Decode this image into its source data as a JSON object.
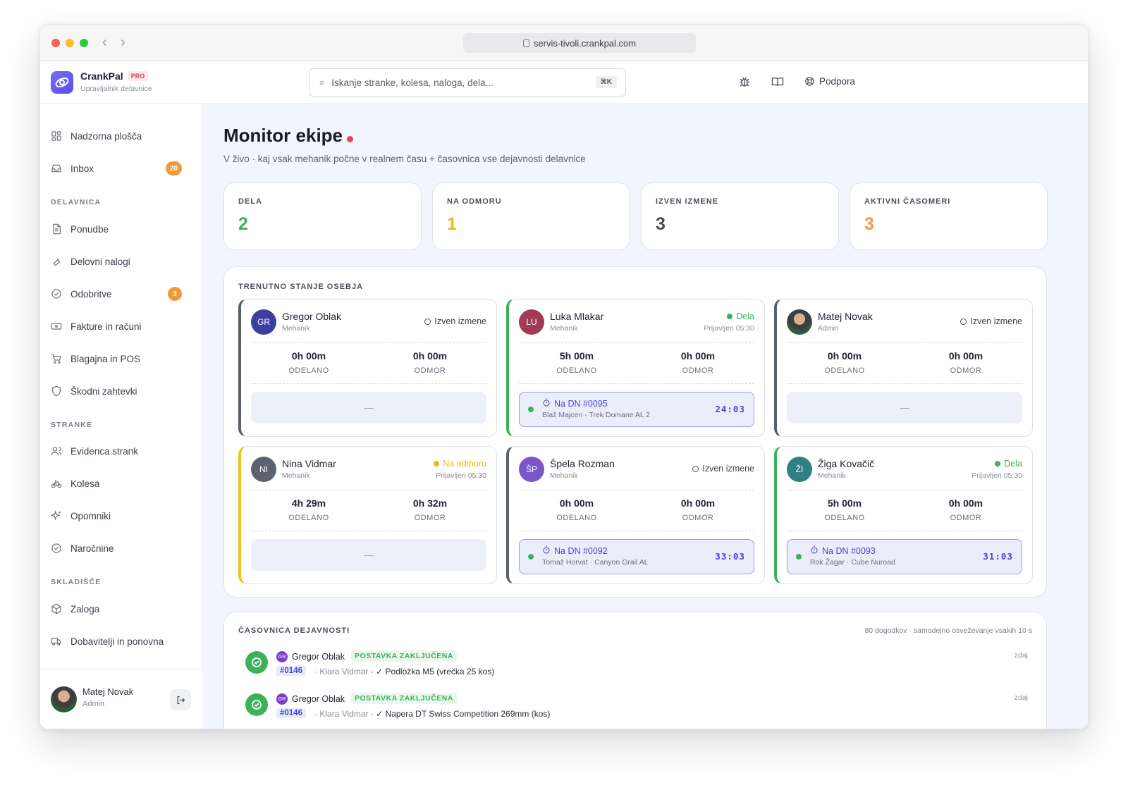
{
  "browser": {
    "url": "servis-tivoli.crankpal.com"
  },
  "brand": {
    "name": "CrankPal",
    "badge": "PRO",
    "subtitle": "Upravljalnik delavnice"
  },
  "search": {
    "placeholder": "Iskanje stranke, kolesa, naloga, dela...",
    "shortcut": "⌘K"
  },
  "topbar": {
    "support_label": "Podpora"
  },
  "sidebar": {
    "items_top": [
      {
        "label": "Nadzorna plošča",
        "icon": "dashboard-icon"
      },
      {
        "label": "Inbox",
        "icon": "inbox-icon",
        "badge": "20"
      }
    ],
    "sections": [
      {
        "title": "DELAVNICA",
        "items": [
          {
            "label": "Ponudbe",
            "icon": "document-icon"
          },
          {
            "label": "Delovni nalogi",
            "icon": "wrench-icon"
          },
          {
            "label": "Odobritve",
            "icon": "check-circle-icon",
            "badge": "3"
          },
          {
            "label": "Fakture in računi",
            "icon": "banknote-icon"
          },
          {
            "label": "Blagajna in POS",
            "icon": "cart-icon"
          },
          {
            "label": "Škodni zahtevki",
            "icon": "shield-icon"
          }
        ]
      },
      {
        "title": "STRANKE",
        "items": [
          {
            "label": "Evidenca strank",
            "icon": "users-icon"
          },
          {
            "label": "Kolesa",
            "icon": "bicycle-icon"
          },
          {
            "label": "Opomniki",
            "icon": "sparkle-icon"
          },
          {
            "label": "Naročnine",
            "icon": "check-circle-icon"
          }
        ]
      },
      {
        "title": "SKLADIŠČE",
        "items": [
          {
            "label": "Zaloga",
            "icon": "box-icon"
          },
          {
            "label": "Dobavitelji in ponovna",
            "icon": "truck-icon"
          }
        ]
      }
    ],
    "user": {
      "name": "Matej Novak",
      "role": "Admin"
    }
  },
  "page": {
    "title": "Monitor ekipe",
    "subtitle": "V živo · kaj vsak mehanik počne v realnem času + časovnica vse dejavnosti delavnice"
  },
  "stats": [
    {
      "label": "DELA",
      "value": "2",
      "color": "#3bb25a"
    },
    {
      "label": "NA ODMORU",
      "value": "1",
      "color": "#f2b616"
    },
    {
      "label": "IZVEN IZMENE",
      "value": "3",
      "color": "#4a4e5a"
    },
    {
      "label": "AKTIVNI ČASOMERI",
      "value": "3",
      "color": "#f39a38"
    }
  ],
  "staff_panel": {
    "title": "TRENUTNO STANJE OSEBJA",
    "worked_label": "ODELANO",
    "break_label": "ODMOR",
    "empty_label": "—",
    "cards": [
      {
        "initials": "GR",
        "name": "Gregor Oblak",
        "role": "Mehanik",
        "status": "Izven izmene",
        "status_kind": "off",
        "since": "",
        "worked": "0h 00m",
        "break": "0h 00m",
        "avatar_color": "#3d3f9e",
        "accent": "#5a5f6e",
        "task": null
      },
      {
        "initials": "LU",
        "name": "Luka Mlakar",
        "role": "Mehanik",
        "status": "Dela",
        "status_kind": "working",
        "since": "Prijavljen 05:30",
        "worked": "5h 00m",
        "break": "0h 00m",
        "avatar_color": "#a23a56",
        "accent": "#3bb25a",
        "task": {
          "label": "Na DN #0095",
          "sub": "Blaž Majcen · Trek Domane AL 2",
          "timer": "24:03"
        }
      },
      {
        "initials": "",
        "name": "Matej Novak",
        "role": "Admin",
        "status": "Izven izmene",
        "status_kind": "off",
        "since": "",
        "worked": "0h 00m",
        "break": "0h 00m",
        "avatar_color": "photo",
        "accent": "#5a5f6e",
        "task": null
      },
      {
        "initials": "NI",
        "name": "Nina Vidmar",
        "role": "Mehanik",
        "status": "Na odmoru",
        "status_kind": "break",
        "since": "Prijavljen 05:30",
        "worked": "4h 29m",
        "break": "0h 32m",
        "avatar_color": "#5c6270",
        "accent": "#f2c21b",
        "task": null
      },
      {
        "initials": "ŠP",
        "name": "Špela Rozman",
        "role": "Mehanik",
        "status": "Izven izmene",
        "status_kind": "off",
        "since": "",
        "worked": "0h 00m",
        "break": "0h 00m",
        "avatar_color": "#7a56c9",
        "accent": "#5a5f6e",
        "task": {
          "label": "Na DN #0092",
          "sub": "Tomaž Horvat · Canyon Grail AL",
          "timer": "33:03"
        }
      },
      {
        "initials": "ŽI",
        "name": "Žiga Kovačič",
        "role": "Mehanik",
        "status": "Dela",
        "status_kind": "working",
        "since": "Prijavljen 05:30",
        "worked": "5h 00m",
        "break": "0h 00m",
        "avatar_color": "#2f7f83",
        "accent": "#3bb25a",
        "task": {
          "label": "Na DN #0093",
          "sub": "Rok Žagar · Cube Nuroad",
          "timer": "31:03"
        }
      }
    ]
  },
  "timeline": {
    "title": "ČASOVNICA DEJAVNOSTI",
    "meta": "80 dogodkov · samodejno osveževanje vsakih 10 s",
    "events": [
      {
        "initials": "GR",
        "who": "Gregor Oblak",
        "tag": "POSTAVKA ZAKLJUČENA",
        "ref": "#0146",
        "customer": "Klara Vidmar",
        "text": "✓ Podložka M5 (vrečka 25 kos)",
        "when": "zdaj"
      },
      {
        "initials": "GR",
        "who": "Gregor Oblak",
        "tag": "POSTAVKA ZAKLJUČENA",
        "ref": "#0146",
        "customer": "Klara Vidmar",
        "text": "✓ Napera DT Swiss Competition 269mm (kos)",
        "when": "zdaj"
      }
    ]
  }
}
